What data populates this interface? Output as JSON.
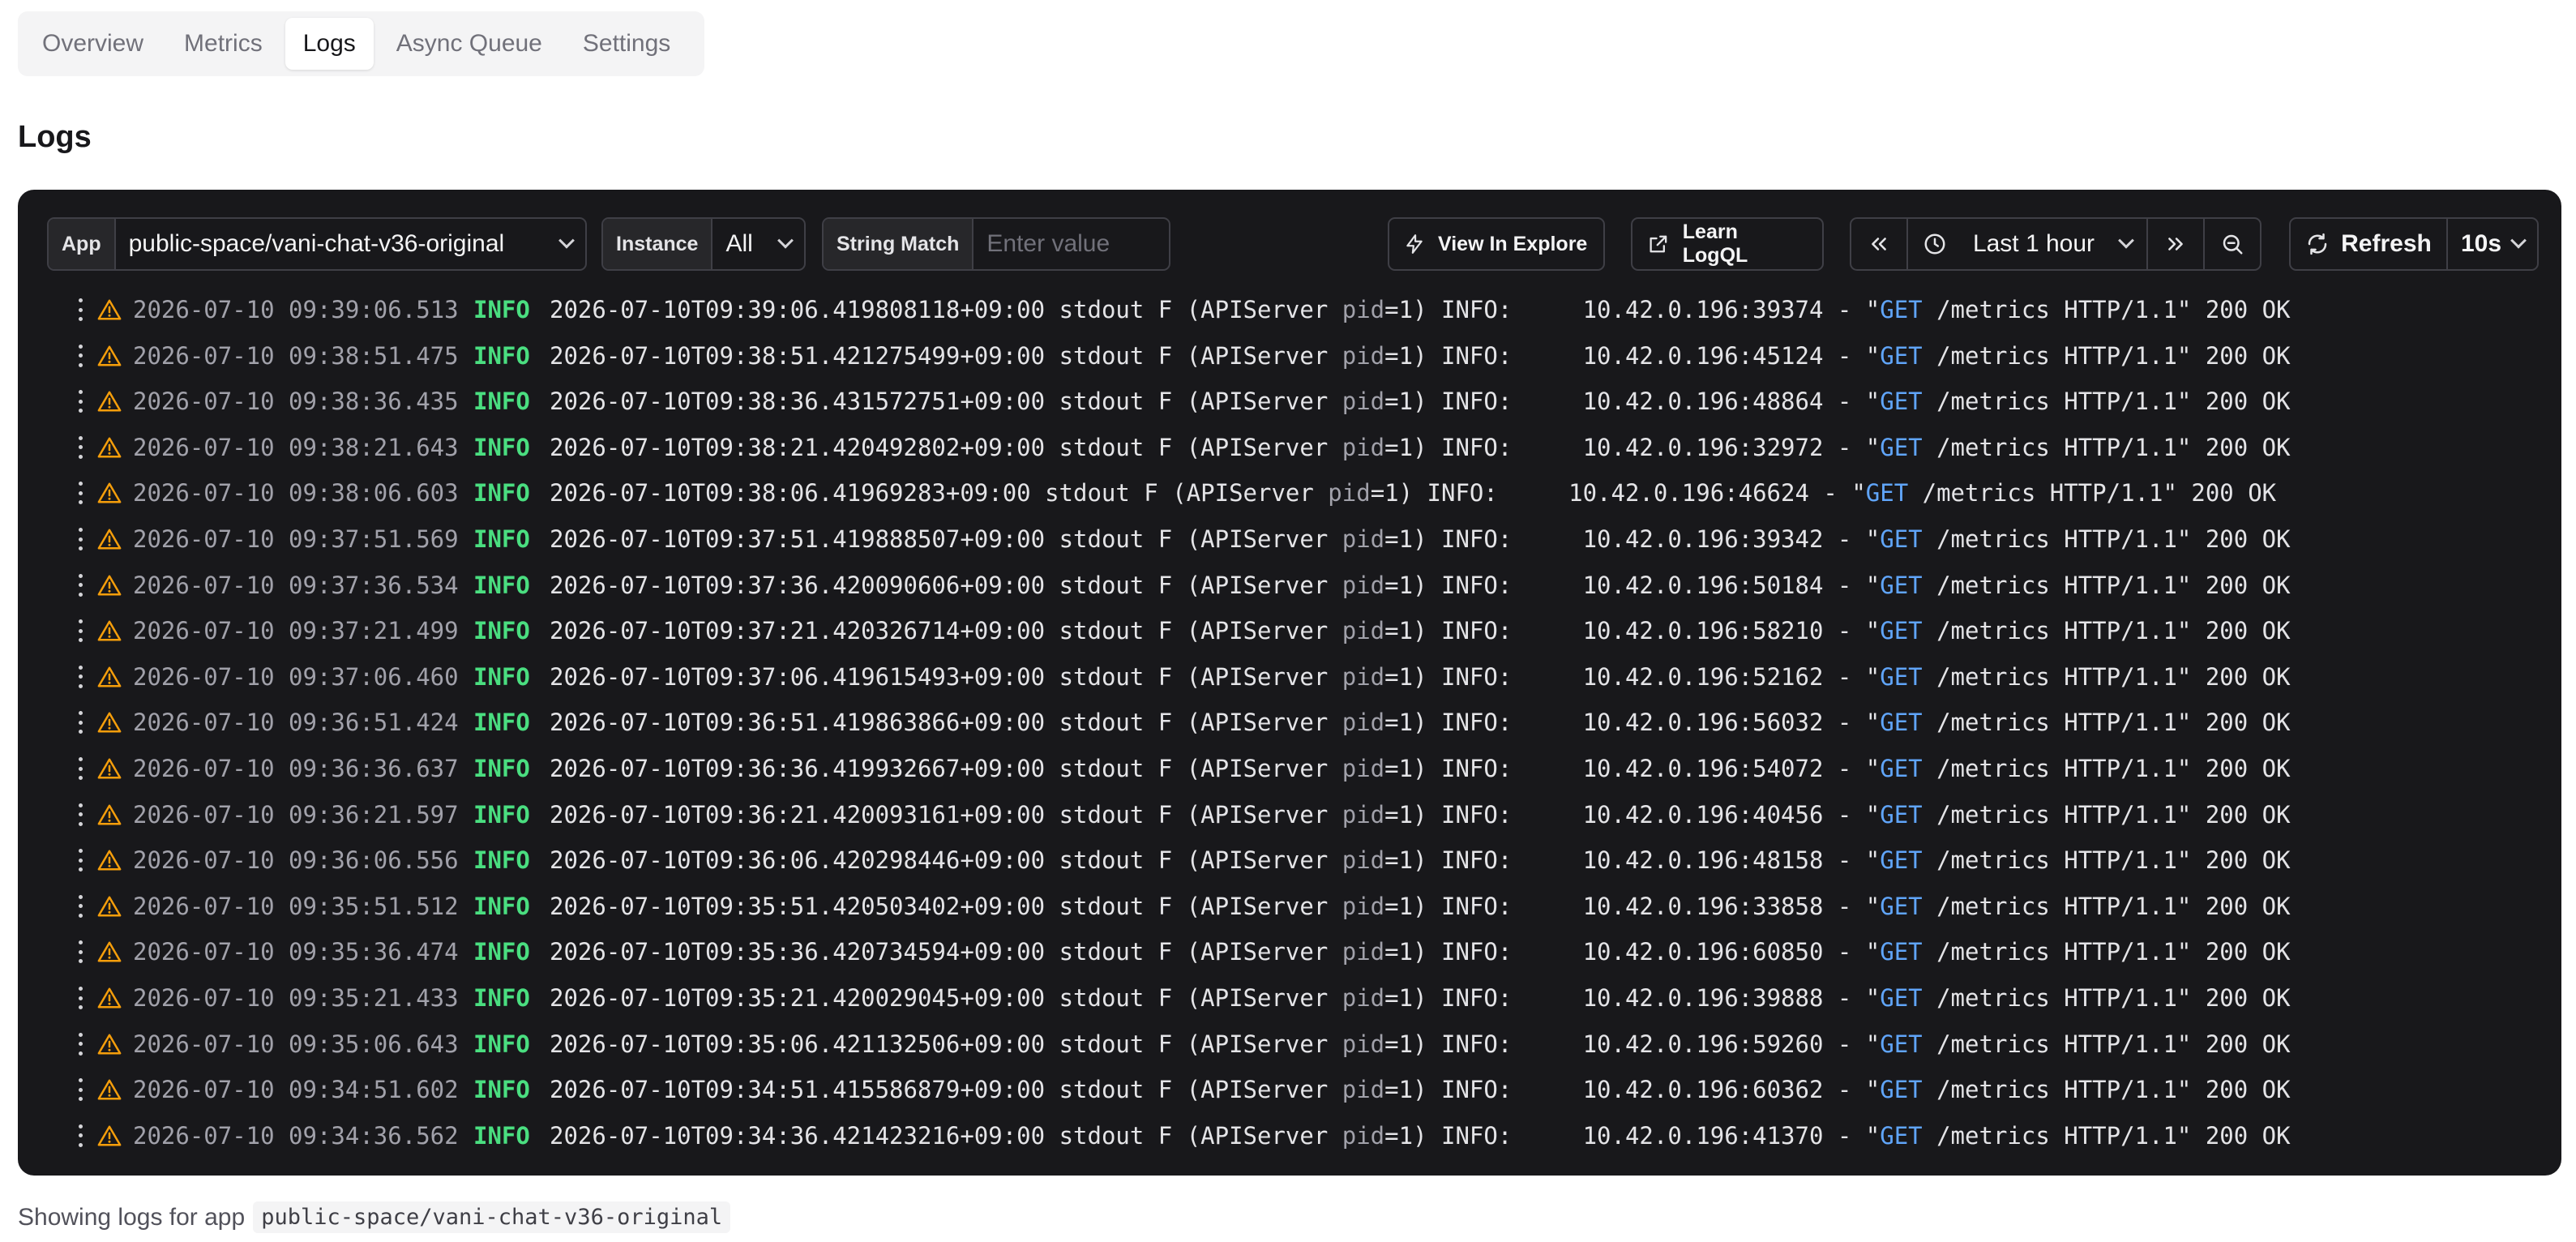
{
  "tabs": [
    {
      "label": "Overview",
      "active": false
    },
    {
      "label": "Metrics",
      "active": false
    },
    {
      "label": "Logs",
      "active": true
    },
    {
      "label": "Async Queue",
      "active": false
    },
    {
      "label": "Settings",
      "active": false
    }
  ],
  "page_title": "Logs",
  "toolbar": {
    "app_label": "App",
    "app_value": "public-space/vani-chat-v36-original",
    "instance_label": "Instance",
    "instance_value": "All",
    "string_match_label": "String Match",
    "string_match_placeholder": "Enter value",
    "view_in_explore": "View In Explore",
    "learn_logql": "Learn LogQL",
    "time_range": "Last 1 hour",
    "refresh": "Refresh",
    "refresh_interval": "10s"
  },
  "colors": {
    "panel_bg": "#18181b",
    "level_info": "#4ade80",
    "warn_icon": "#f59e0b",
    "method": "#60a5fa"
  },
  "logs": [
    {
      "ts": "2026-07-10 09:39:06.513",
      "level": "INFO",
      "iso": "2026-07-10T09:39:06.419808118+09:00",
      "stream": "stdout F (APIServer ",
      "pid_key": "pid",
      "pid_rest": "=1) INFO:     ",
      "addr": "10.42.0.196:39374 - \"",
      "method": "GET",
      "tail": " /metrics HTTP/1.1\" 200 OK"
    },
    {
      "ts": "2026-07-10 09:38:51.475",
      "level": "INFO",
      "iso": "2026-07-10T09:38:51.421275499+09:00",
      "stream": "stdout F (APIServer ",
      "pid_key": "pid",
      "pid_rest": "=1) INFO:     ",
      "addr": "10.42.0.196:45124 - \"",
      "method": "GET",
      "tail": " /metrics HTTP/1.1\" 200 OK"
    },
    {
      "ts": "2026-07-10 09:38:36.435",
      "level": "INFO",
      "iso": "2026-07-10T09:38:36.431572751+09:00",
      "stream": "stdout F (APIServer ",
      "pid_key": "pid",
      "pid_rest": "=1) INFO:     ",
      "addr": "10.42.0.196:48864 - \"",
      "method": "GET",
      "tail": " /metrics HTTP/1.1\" 200 OK"
    },
    {
      "ts": "2026-07-10 09:38:21.643",
      "level": "INFO",
      "iso": "2026-07-10T09:38:21.420492802+09:00",
      "stream": "stdout F (APIServer ",
      "pid_key": "pid",
      "pid_rest": "=1) INFO:     ",
      "addr": "10.42.0.196:32972 - \"",
      "method": "GET",
      "tail": " /metrics HTTP/1.1\" 200 OK"
    },
    {
      "ts": "2026-07-10 09:38:06.603",
      "level": "INFO",
      "iso": "2026-07-10T09:38:06.41969283+09:00",
      "stream": "stdout F (APIServer ",
      "pid_key": "pid",
      "pid_rest": "=1) INFO:     ",
      "addr": "10.42.0.196:46624 - \"",
      "method": "GET",
      "tail": " /metrics HTTP/1.1\" 200 OK"
    },
    {
      "ts": "2026-07-10 09:37:51.569",
      "level": "INFO",
      "iso": "2026-07-10T09:37:51.419888507+09:00",
      "stream": "stdout F (APIServer ",
      "pid_key": "pid",
      "pid_rest": "=1) INFO:     ",
      "addr": "10.42.0.196:39342 - \"",
      "method": "GET",
      "tail": " /metrics HTTP/1.1\" 200 OK"
    },
    {
      "ts": "2026-07-10 09:37:36.534",
      "level": "INFO",
      "iso": "2026-07-10T09:37:36.420090606+09:00",
      "stream": "stdout F (APIServer ",
      "pid_key": "pid",
      "pid_rest": "=1) INFO:     ",
      "addr": "10.42.0.196:50184 - \"",
      "method": "GET",
      "tail": " /metrics HTTP/1.1\" 200 OK"
    },
    {
      "ts": "2026-07-10 09:37:21.499",
      "level": "INFO",
      "iso": "2026-07-10T09:37:21.420326714+09:00",
      "stream": "stdout F (APIServer ",
      "pid_key": "pid",
      "pid_rest": "=1) INFO:     ",
      "addr": "10.42.0.196:58210 - \"",
      "method": "GET",
      "tail": " /metrics HTTP/1.1\" 200 OK"
    },
    {
      "ts": "2026-07-10 09:37:06.460",
      "level": "INFO",
      "iso": "2026-07-10T09:37:06.419615493+09:00",
      "stream": "stdout F (APIServer ",
      "pid_key": "pid",
      "pid_rest": "=1) INFO:     ",
      "addr": "10.42.0.196:52162 - \"",
      "method": "GET",
      "tail": " /metrics HTTP/1.1\" 200 OK"
    },
    {
      "ts": "2026-07-10 09:36:51.424",
      "level": "INFO",
      "iso": "2026-07-10T09:36:51.419863866+09:00",
      "stream": "stdout F (APIServer ",
      "pid_key": "pid",
      "pid_rest": "=1) INFO:     ",
      "addr": "10.42.0.196:56032 - \"",
      "method": "GET",
      "tail": " /metrics HTTP/1.1\" 200 OK"
    },
    {
      "ts": "2026-07-10 09:36:36.637",
      "level": "INFO",
      "iso": "2026-07-10T09:36:36.419932667+09:00",
      "stream": "stdout F (APIServer ",
      "pid_key": "pid",
      "pid_rest": "=1) INFO:     ",
      "addr": "10.42.0.196:54072 - \"",
      "method": "GET",
      "tail": " /metrics HTTP/1.1\" 200 OK"
    },
    {
      "ts": "2026-07-10 09:36:21.597",
      "level": "INFO",
      "iso": "2026-07-10T09:36:21.420093161+09:00",
      "stream": "stdout F (APIServer ",
      "pid_key": "pid",
      "pid_rest": "=1) INFO:     ",
      "addr": "10.42.0.196:40456 - \"",
      "method": "GET",
      "tail": " /metrics HTTP/1.1\" 200 OK"
    },
    {
      "ts": "2026-07-10 09:36:06.556",
      "level": "INFO",
      "iso": "2026-07-10T09:36:06.420298446+09:00",
      "stream": "stdout F (APIServer ",
      "pid_key": "pid",
      "pid_rest": "=1) INFO:     ",
      "addr": "10.42.0.196:48158 - \"",
      "method": "GET",
      "tail": " /metrics HTTP/1.1\" 200 OK"
    },
    {
      "ts": "2026-07-10 09:35:51.512",
      "level": "INFO",
      "iso": "2026-07-10T09:35:51.420503402+09:00",
      "stream": "stdout F (APIServer ",
      "pid_key": "pid",
      "pid_rest": "=1) INFO:     ",
      "addr": "10.42.0.196:33858 - \"",
      "method": "GET",
      "tail": " /metrics HTTP/1.1\" 200 OK"
    },
    {
      "ts": "2026-07-10 09:35:36.474",
      "level": "INFO",
      "iso": "2026-07-10T09:35:36.420734594+09:00",
      "stream": "stdout F (APIServer ",
      "pid_key": "pid",
      "pid_rest": "=1) INFO:     ",
      "addr": "10.42.0.196:60850 - \"",
      "method": "GET",
      "tail": " /metrics HTTP/1.1\" 200 OK"
    },
    {
      "ts": "2026-07-10 09:35:21.433",
      "level": "INFO",
      "iso": "2026-07-10T09:35:21.420029045+09:00",
      "stream": "stdout F (APIServer ",
      "pid_key": "pid",
      "pid_rest": "=1) INFO:     ",
      "addr": "10.42.0.196:39888 - \"",
      "method": "GET",
      "tail": " /metrics HTTP/1.1\" 200 OK"
    },
    {
      "ts": "2026-07-10 09:35:06.643",
      "level": "INFO",
      "iso": "2026-07-10T09:35:06.421132506+09:00",
      "stream": "stdout F (APIServer ",
      "pid_key": "pid",
      "pid_rest": "=1) INFO:     ",
      "addr": "10.42.0.196:59260 - \"",
      "method": "GET",
      "tail": " /metrics HTTP/1.1\" 200 OK"
    },
    {
      "ts": "2026-07-10 09:34:51.602",
      "level": "INFO",
      "iso": "2026-07-10T09:34:51.415586879+09:00",
      "stream": "stdout F (APIServer ",
      "pid_key": "pid",
      "pid_rest": "=1) INFO:     ",
      "addr": "10.42.0.196:60362 - \"",
      "method": "GET",
      "tail": " /metrics HTTP/1.1\" 200 OK"
    },
    {
      "ts": "2026-07-10 09:34:36.562",
      "level": "INFO",
      "iso": "2026-07-10T09:34:36.421423216+09:00",
      "stream": "stdout F (APIServer ",
      "pid_key": "pid",
      "pid_rest": "=1) INFO:     ",
      "addr": "10.42.0.196:41370 - \"",
      "method": "GET",
      "tail": " /metrics HTTP/1.1\" 200 OK"
    }
  ],
  "footer": {
    "text": "Showing logs for app",
    "app_code": "public-space/vani-chat-v36-original"
  }
}
